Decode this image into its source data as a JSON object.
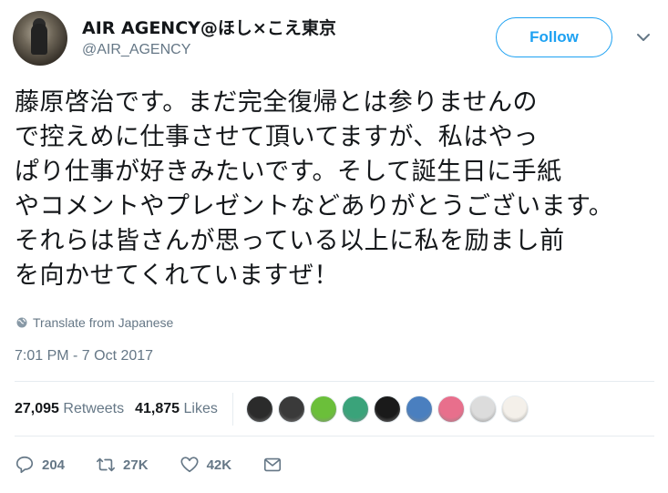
{
  "user": {
    "display_name": "AIR AGENCY@ほし×こえ東京",
    "handle": "@AIR_AGENCY"
  },
  "follow_label": "Follow",
  "tweet": {
    "text": "藤原啓治です。まだ完全復帰とは参りませんの\nで控えめに仕事させて頂いてますが、私はやっ\nぱり仕事が好きみたいです。そして誕生日に手紙\nやコメントやプレゼントなどありがとうございます。\nそれらは皆さんが思っている以上に私を励まし前\nを向かせてくれていますぜ！"
  },
  "translate_label": "Translate from Japanese",
  "timestamp": "7:01 PM - 7 Oct 2017",
  "stats": {
    "retweets_count": "27,095",
    "retweets_label": "Retweets",
    "likes_count": "41,875",
    "likes_label": "Likes"
  },
  "likers": [
    "#2b2b2b",
    "#3a3a3a",
    "#6bbf3a",
    "#3aa37a",
    "#1a1a1a",
    "#4a7fbf",
    "#e86f8c",
    "#dcdcdc",
    "#f4f0ea"
  ],
  "actions": {
    "reply_count": "204",
    "retweet_count": "27K",
    "like_count": "42K"
  },
  "colors": {
    "accent": "#1da1f2",
    "muted": "#657786",
    "text": "#14171a",
    "divider": "#e6ecf0"
  }
}
